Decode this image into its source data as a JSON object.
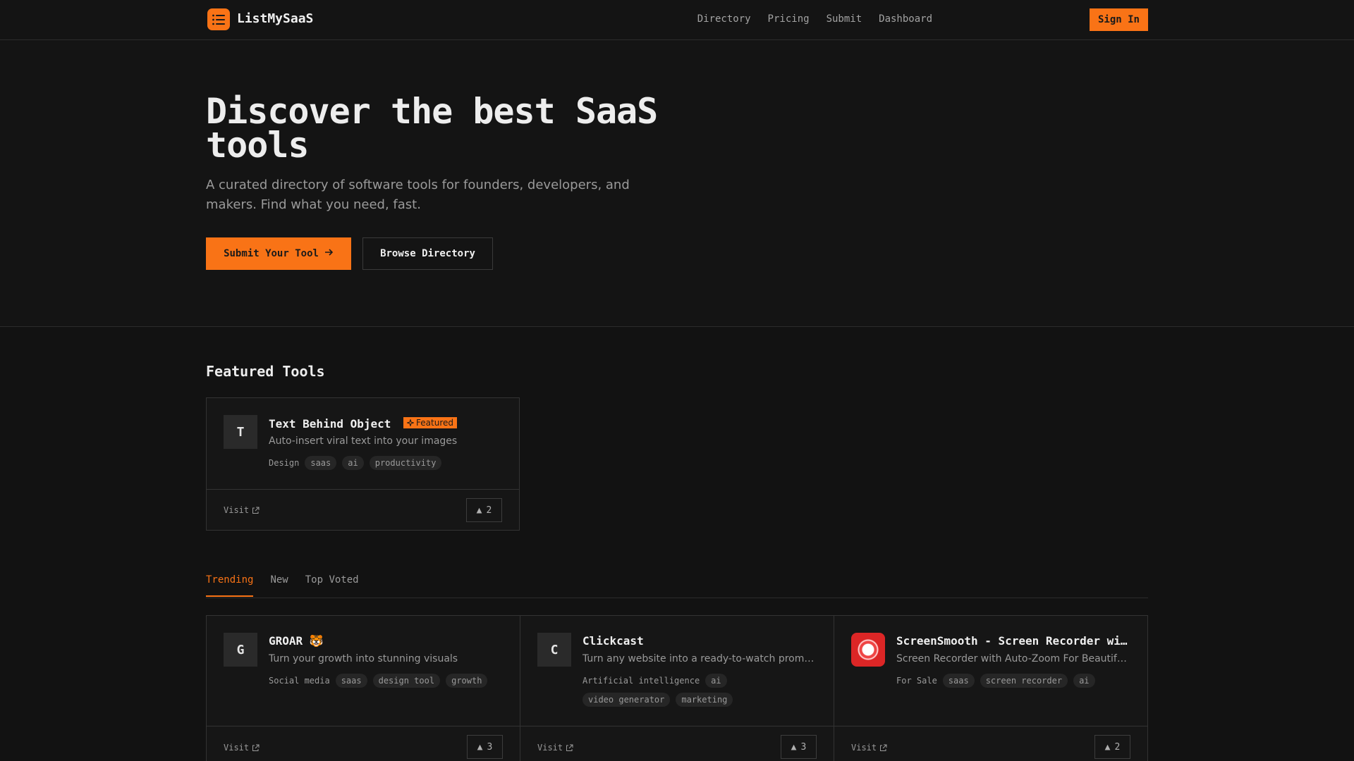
{
  "nav": {
    "brand": "ListMySaaS",
    "links": [
      "Directory",
      "Pricing",
      "Submit",
      "Dashboard"
    ],
    "signin": "Sign In"
  },
  "hero": {
    "title": "Discover the best SaaS tools",
    "subtitle": "A curated directory of software tools for founders, developers, and makers. Find what you need, fast.",
    "primary_cta": "Submit Your Tool",
    "secondary_cta": "Browse Directory"
  },
  "featured": {
    "title": "Featured Tools",
    "badge": "Featured",
    "visit_label": "Visit",
    "card": {
      "initial": "T",
      "name": "Text Behind Object",
      "description": "Auto-insert viral text into your images",
      "category": "Design",
      "tags": [
        "saas",
        "ai",
        "productivity"
      ],
      "votes": "2"
    }
  },
  "tabs": {
    "items": [
      "Trending",
      "New",
      "Top Voted"
    ],
    "active": "Trending"
  },
  "trending": [
    {
      "initial": "G",
      "name": "GROAR 🐯",
      "description": "Turn your growth into stunning visuals",
      "category": "Social media",
      "tags": [
        "saas",
        "design tool",
        "growth"
      ],
      "votes": "3",
      "visit": "Visit"
    },
    {
      "initial": "C",
      "name": "Clickcast",
      "description": "Turn any website into a ready-to-watch promo...",
      "category": "Artificial intelligence",
      "tags": [
        "ai",
        "video generator",
        "marketing"
      ],
      "votes": "3",
      "visit": "Visit"
    },
    {
      "initial": "",
      "name": "ScreenSmooth - Screen Recorder wi...",
      "description": "Screen Recorder with Auto-Zoom For Beautiful...",
      "category": "For Sale",
      "tags": [
        "saas",
        "screen recorder",
        "ai"
      ],
      "votes": "2",
      "visit": "Visit"
    }
  ],
  "colors": {
    "accent": "#f97316",
    "background": "#141414"
  }
}
